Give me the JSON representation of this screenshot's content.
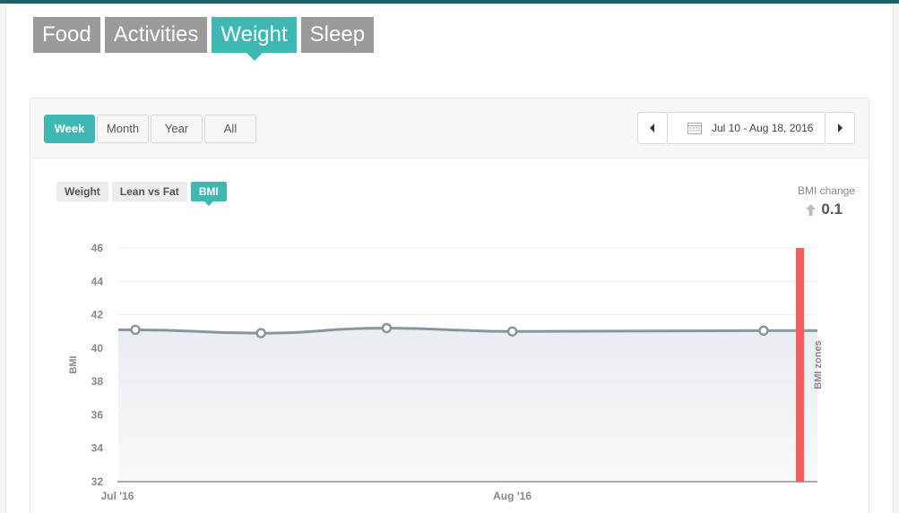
{
  "nav": {
    "tabs": [
      {
        "label": "Food",
        "active": false
      },
      {
        "label": "Activities",
        "active": false
      },
      {
        "label": "Weight",
        "active": true
      },
      {
        "label": "Sleep",
        "active": false
      }
    ]
  },
  "range": {
    "buttons": [
      {
        "label": "Week",
        "active": true
      },
      {
        "label": "Month",
        "active": false
      },
      {
        "label": "Year",
        "active": false
      },
      {
        "label": "All",
        "active": false
      }
    ]
  },
  "date_nav": {
    "range_label": "Jul 10 - Aug 18, 2016",
    "prev_icon": "caret-left-icon",
    "next_icon": "caret-right-icon",
    "calendar_icon": "calendar-icon"
  },
  "subtabs": [
    {
      "label": "Weight",
      "active": false
    },
    {
      "label": "Lean vs Fat",
      "active": false
    },
    {
      "label": "BMI",
      "active": true
    }
  ],
  "bmi_change": {
    "label": "BMI change",
    "value": "0.1",
    "direction_icon": "arrow-up-icon"
  },
  "colors": {
    "accent": "#3fb8b3",
    "nav_inactive": "#9a9a9a",
    "line": "#8a969f",
    "zone_bar": "#f55d5d",
    "top_bar": "#1f5f66"
  },
  "chart_data": {
    "type": "line",
    "ylabel": "BMI",
    "right_label": "BMI zones",
    "ylim": [
      32,
      46
    ],
    "yticks": [
      32,
      34,
      36,
      38,
      40,
      42,
      44,
      46
    ],
    "xlim": [
      "2016-07-10",
      "2016-08-18"
    ],
    "xticks": [
      {
        "date": "2016-07-10",
        "label": "Jul '16"
      },
      {
        "date": "2016-08-01",
        "label": "Aug '16"
      }
    ],
    "series": [
      {
        "points": [
          {
            "x": "2016-07-11",
            "y": 41.1
          },
          {
            "x": "2016-07-18",
            "y": 40.9
          },
          {
            "x": "2016-07-25",
            "y": 41.2
          },
          {
            "x": "2016-08-01",
            "y": 41.0
          },
          {
            "x": "2016-08-15",
            "y": 41.05
          }
        ],
        "line_end": {
          "x": "2016-08-18",
          "y": 41.05
        }
      }
    ],
    "grid": true,
    "area_fill": true
  }
}
